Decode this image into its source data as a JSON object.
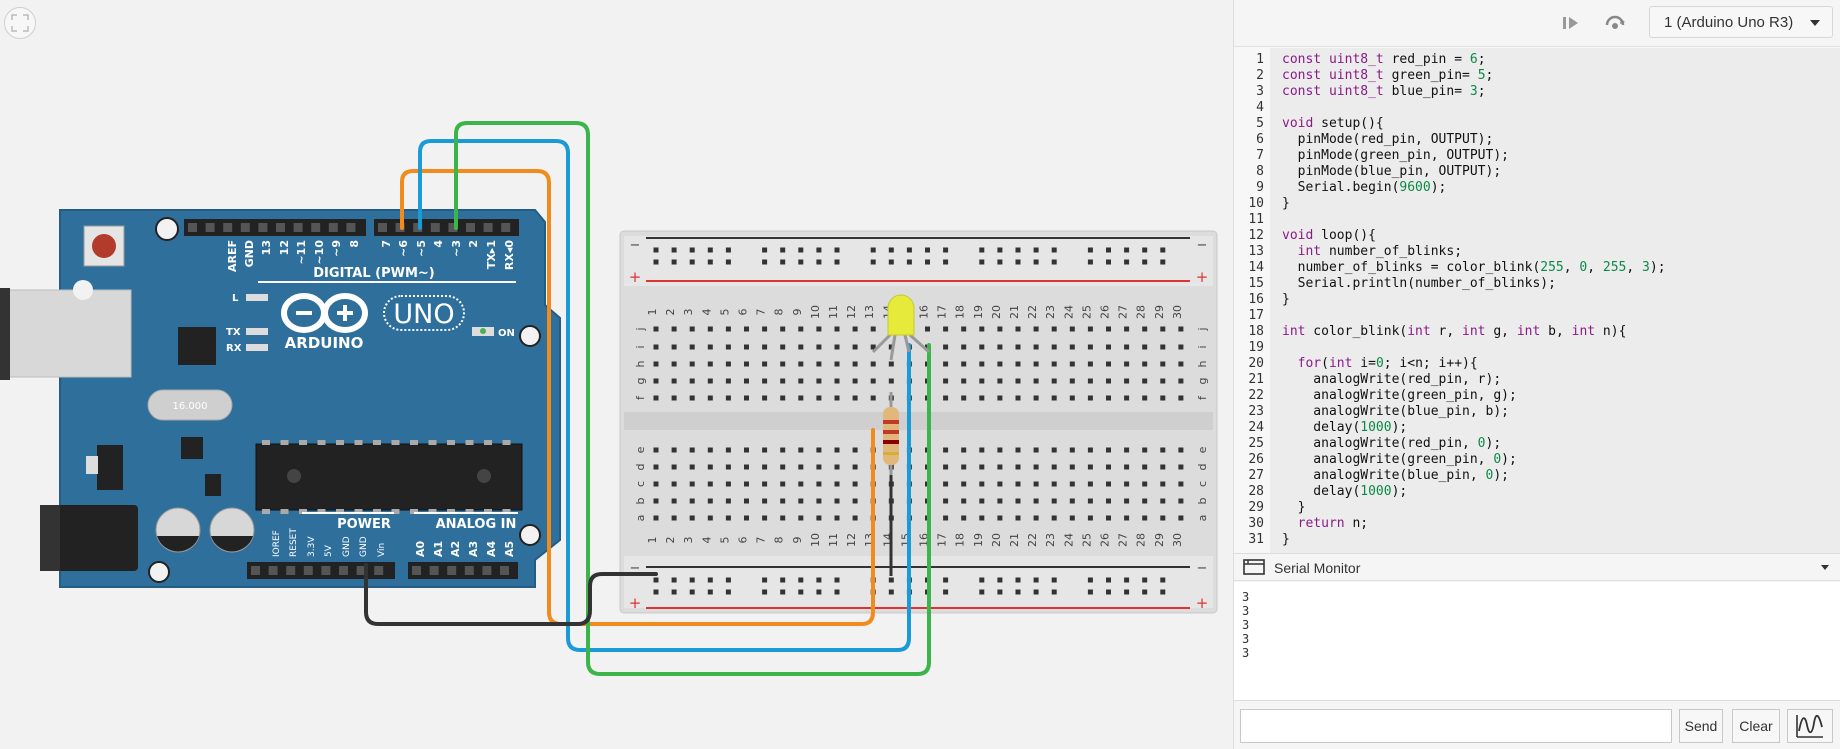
{
  "canvas": {
    "board": {
      "brand": "ARDUINO",
      "model": "UNO",
      "digital_label": "DIGITAL (PWM~)",
      "power_label": "POWER",
      "analog_label": "ANALOG IN",
      "on_label": "ON",
      "led_labels": [
        "L",
        "TX",
        "RX"
      ],
      "digital_pins": [
        "AREF",
        "GND",
        "13",
        "12",
        "~11",
        "~10",
        "~9",
        "8",
        "7",
        "~6",
        "~5",
        "4",
        "~3",
        "2",
        "TX▸1",
        "RX◂0"
      ],
      "power_pins": [
        "IOREF",
        "RESET",
        "3.3V",
        "5V",
        "GND",
        "GND",
        "Vin"
      ],
      "analog_pins": [
        "A0",
        "A1",
        "A2",
        "A3",
        "A4",
        "A5"
      ],
      "crystal_label": "16.000"
    },
    "breadboard": {
      "columns": [
        "1",
        "2",
        "3",
        "4",
        "5",
        "6",
        "7",
        "8",
        "9",
        "10",
        "11",
        "12",
        "13",
        "14",
        "15",
        "16",
        "17",
        "18",
        "19",
        "20",
        "21",
        "22",
        "23",
        "24",
        "25",
        "26",
        "27",
        "28",
        "29",
        "30"
      ],
      "rows_top": [
        "j",
        "i",
        "h",
        "g",
        "f"
      ],
      "rows_bottom": [
        "e",
        "d",
        "c",
        "b",
        "a"
      ],
      "minus": "−",
      "plus": "+"
    },
    "wire_colors": {
      "orange": "#f08c1e",
      "blue": "#1a9ad6",
      "green": "#3bb54a",
      "black": "#333333"
    }
  },
  "toolbar": {
    "device_select": "1 (Arduino Uno R3)",
    "play_icon": "step-play-icon",
    "reset_icon": "restart-icon"
  },
  "editor": {
    "lines": [
      "const uint8_t red_pin = 6;",
      "const uint8_t green_pin= 5;",
      "const uint8_t blue_pin= 3;",
      "",
      "void setup(){",
      "  pinMode(red_pin, OUTPUT);",
      "  pinMode(green_pin, OUTPUT);",
      "  pinMode(blue_pin, OUTPUT);",
      "  Serial.begin(9600);",
      "}",
      "",
      "void loop(){",
      "  int number_of_blinks;",
      "  number_of_blinks = color_blink(255, 0, 255, 3);",
      "  Serial.println(number_of_blinks);",
      "}",
      "",
      "int color_blink(int r, int g, int b, int n){",
      "",
      "  for(int i=0; i<n; i++){",
      "    analogWrite(red_pin, r);",
      "    analogWrite(green_pin, g);",
      "    analogWrite(blue_pin, b);",
      "    delay(1000);",
      "    analogWrite(red_pin, 0);",
      "    analogWrite(green_pin, 0);",
      "    analogWrite(blue_pin, 0);",
      "    delay(1000);",
      "  }",
      "  return n;",
      "}"
    ]
  },
  "serial_monitor": {
    "title": "Serial Monitor",
    "output": [
      "3",
      "3",
      "3",
      "3",
      "3"
    ],
    "input_placeholder": "",
    "send_label": "Send",
    "clear_label": "Clear",
    "graph_icon": "graph-icon"
  }
}
